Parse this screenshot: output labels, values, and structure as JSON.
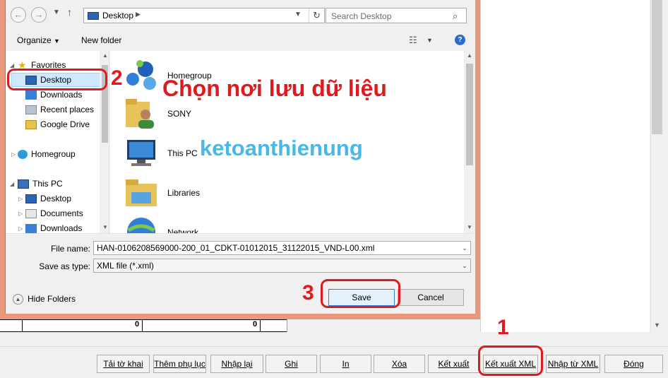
{
  "dialog": {
    "address": {
      "location": "Desktop"
    },
    "search": {
      "placeholder": "Search Desktop"
    },
    "toolbar": {
      "organize_label": "Organize",
      "new_folder_label": "New folder",
      "help_glyph": "?"
    },
    "nav_items": [
      {
        "label": "Favorites",
        "icon": "star-icon"
      },
      {
        "label": "Desktop",
        "icon": "desktop-icon",
        "selected": true
      },
      {
        "label": "Downloads",
        "icon": "downloads-icon"
      },
      {
        "label": "Recent places",
        "icon": "recent-places-icon"
      },
      {
        "label": "Google Drive",
        "icon": "google-drive-icon"
      },
      {
        "label": "Homegroup",
        "icon": "homegroup-icon"
      },
      {
        "label": "This PC",
        "icon": "this-pc-icon"
      },
      {
        "label": "Desktop",
        "icon": "desktop-icon"
      },
      {
        "label": "Documents",
        "icon": "documents-icon"
      },
      {
        "label": "Downloads",
        "icon": "downloads-icon"
      }
    ],
    "files": [
      {
        "label": "Homegroup",
        "icon": "homegroup-icon"
      },
      {
        "label": "SONY",
        "icon": "user-folder-icon"
      },
      {
        "label": "This PC",
        "icon": "computer-icon"
      },
      {
        "label": "Libraries",
        "icon": "libraries-icon"
      },
      {
        "label": "Network",
        "icon": "network-icon"
      }
    ],
    "file_name": {
      "label": "File name:",
      "value": "HAN-0106208569000-200_01_CDKT-01012015_31122015_VND-L00.xml"
    },
    "save_as_type": {
      "label": "Save as type:",
      "value": "XML file (*.xml)"
    },
    "hide_folders_label": "Hide Folders",
    "save_label": "Save",
    "cancel_label": "Cancel"
  },
  "background": {
    "grid_values": [
      "0",
      "0"
    ],
    "bottom_buttons": [
      "Tải tờ khai",
      "Thêm phụ lục",
      "Nhập lại",
      "Ghi",
      "In",
      "Xóa",
      "Kết xuất",
      "Kết xuất XML",
      "Nhập từ XML",
      "Đóng"
    ]
  },
  "annotations": {
    "step1": "1",
    "step2": "2",
    "step3": "3",
    "title": "Chọn nơi lưu dữ liệu",
    "watermark": "ketoanthienung"
  },
  "colors": {
    "annotation_red": "#e0191f",
    "watermark_blue": "#49b8e6",
    "dialog_frame": "#e9987c",
    "selection": "#cde8ff"
  }
}
